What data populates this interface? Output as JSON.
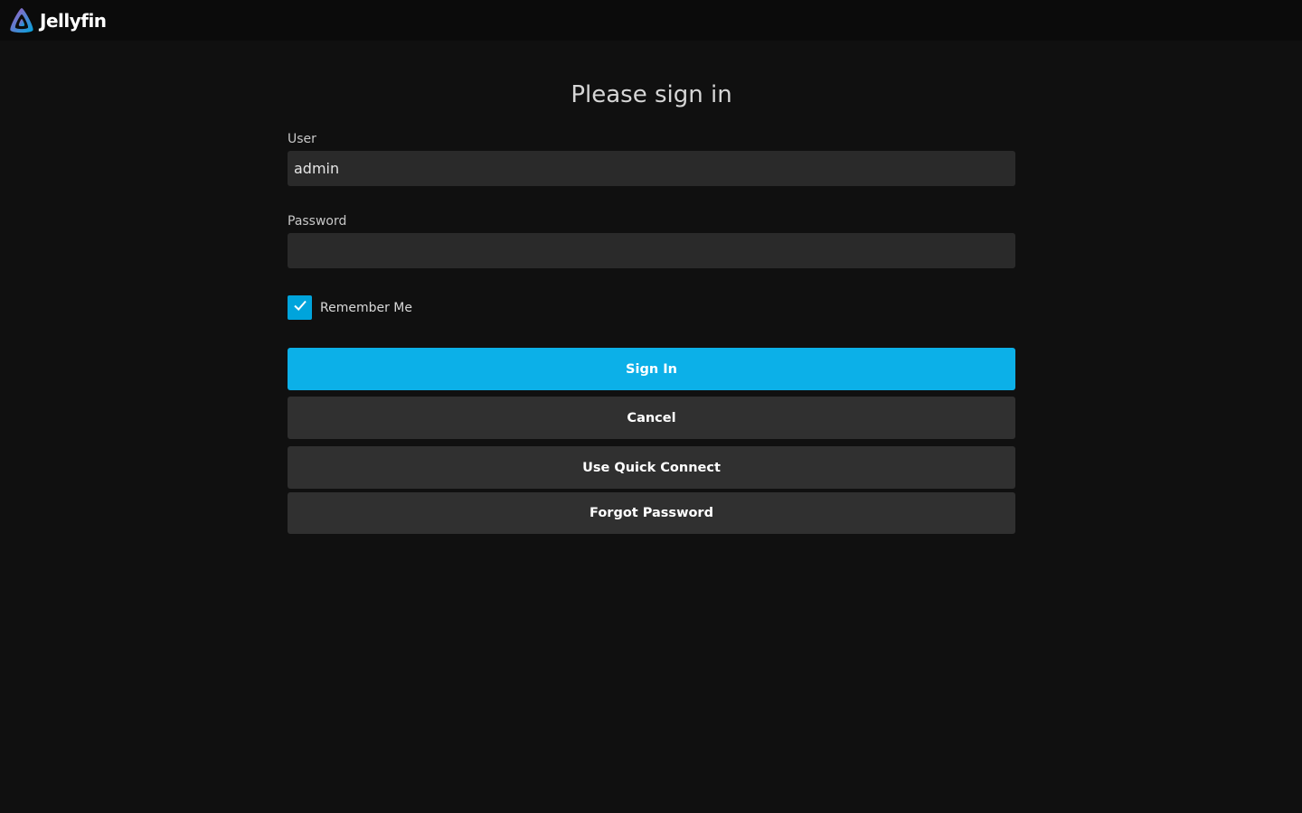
{
  "app": {
    "name": "Jellyfin"
  },
  "colors": {
    "accent": "#00a4dc",
    "primary_button": "#0cb0e8",
    "background": "#101010",
    "topbar": "#0b0b0b",
    "input": "#2a2a2a",
    "secondary_button": "#303030"
  },
  "icons": {
    "logo": "jellyfin-logo-icon",
    "checkbox": "checkmark-icon"
  },
  "login": {
    "title": "Please sign in",
    "user_label": "User",
    "user_value": "admin",
    "password_label": "Password",
    "password_value": "",
    "remember_label": "Remember Me",
    "remember_checked": true
  },
  "buttons": {
    "sign_in": "Sign In",
    "cancel": "Cancel",
    "quick_connect": "Use Quick Connect",
    "forgot_password": "Forgot Password"
  }
}
